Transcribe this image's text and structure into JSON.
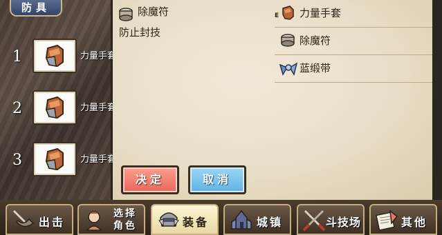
{
  "category_tag": "防具",
  "slots": [
    {
      "num": "1",
      "name": "力量手套",
      "icon": "gauntlet-icon"
    },
    {
      "num": "2",
      "name": "力量手套",
      "icon": "gauntlet-icon"
    },
    {
      "num": "3",
      "name": "力量手套",
      "icon": "gauntlet-icon"
    }
  ],
  "detail": {
    "icon": "amulet-icon",
    "title": "除魔符",
    "description": "防止封技"
  },
  "item_list": [
    {
      "label": "力量手套",
      "icon": "gauntlet-icon",
      "marker": "E"
    },
    {
      "label": "除魔符",
      "icon": "amulet-icon",
      "marker": ""
    },
    {
      "label": "蓝缎带",
      "icon": "ribbon-icon",
      "marker": ""
    }
  ],
  "buttons": {
    "confirm": "决定",
    "cancel": "取消"
  },
  "nav": [
    {
      "label": "出击",
      "icon": "sortie-icon"
    },
    {
      "label": "选择角色",
      "line1": "选择",
      "line2": "角色",
      "icon": "character-icon"
    },
    {
      "label": "装备",
      "icon": "equipment-icon",
      "active": true
    },
    {
      "label": "城镇",
      "icon": "town-icon"
    },
    {
      "label": "斗技场",
      "icon": "arena-icon"
    },
    {
      "label": "其他",
      "icon": "other-icon"
    }
  ],
  "colors": {
    "confirm": "#e4675a",
    "cancel": "#5fb1e4",
    "parchment": "#ece2cc",
    "tab_accent": "#c4ad7e"
  }
}
